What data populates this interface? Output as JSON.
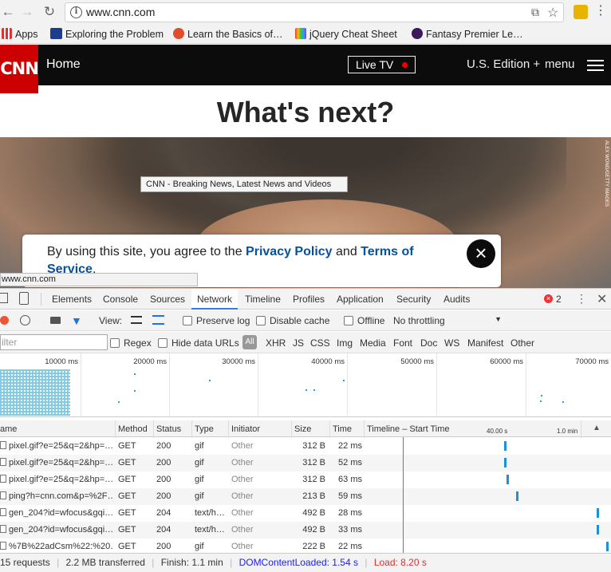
{
  "browser": {
    "url": "www.cnn.com",
    "bookmarks": [
      {
        "label": "Apps",
        "icon": "apps-grid-icon"
      },
      {
        "label": "Exploring the Problem",
        "icon": "ub-logo-icon"
      },
      {
        "label": "Learn the Basics of…",
        "icon": "jsbin-icon"
      },
      {
        "label": "jQuery Cheat Sheet",
        "icon": "rainbow-icon"
      },
      {
        "label": "Fantasy Premier Le…",
        "icon": "premier-league-icon"
      }
    ]
  },
  "cnn": {
    "logo": "CNN",
    "nav_home": "Home",
    "live_tv": "Live TV",
    "edition": "U.S. Edition +",
    "menu": "menu",
    "headline": "What's next?",
    "photo_credit": "ALEX WONG/GETTY IMAGES",
    "tooltip": "CNN - Breaking News, Latest News and Videos",
    "consent": {
      "prefix": "By using this site, you agree to the",
      "privacy": "Privacy Policy",
      "and": "and",
      "terms": "Terms of Service",
      "suffix": "."
    },
    "status_url": "www.cnn.com"
  },
  "devtools": {
    "tabs": [
      "Elements",
      "Console",
      "Sources",
      "Network",
      "Timeline",
      "Profiles",
      "Application",
      "Security",
      "Audits"
    ],
    "active_tab": "Network",
    "error_count": "2",
    "view_label": "View:",
    "preserve_log": "Preserve log",
    "disable_cache": "Disable cache",
    "offline": "Offline",
    "throttling": "No throttling",
    "filter_placeholder": "ilter",
    "regex": "Regex",
    "hide_data_urls": "Hide data URLs",
    "all": "All",
    "filter_types": [
      "XHR",
      "JS",
      "CSS",
      "Img",
      "Media",
      "Font",
      "Doc",
      "WS",
      "Manifest",
      "Other"
    ],
    "overview_ticks": [
      "10000 ms",
      "20000 ms",
      "30000 ms",
      "40000 ms",
      "50000 ms",
      "60000 ms",
      "70000 ms"
    ],
    "columns": {
      "name": "ame",
      "method": "Method",
      "status": "Status",
      "type": "Type",
      "initiator": "Initiator",
      "size": "Size",
      "time": "Time",
      "timeline": "Timeline – Start Time",
      "tl_mark1": "40.00 s",
      "tl_mark2": "1.0 min"
    },
    "requests": [
      {
        "name": "pixel.gif?e=25&q=2&hp=…",
        "method": "GET",
        "status": "200",
        "type": "gif",
        "initiator": "Other",
        "size": "312 B",
        "time": "22 ms",
        "start_fraction": 0.57
      },
      {
        "name": "pixel.gif?e=25&q=2&hp=…",
        "method": "GET",
        "status": "200",
        "type": "gif",
        "initiator": "Other",
        "size": "312 B",
        "time": "52 ms",
        "start_fraction": 0.57
      },
      {
        "name": "pixel.gif?e=25&q=2&hp=…",
        "method": "GET",
        "status": "200",
        "type": "gif",
        "initiator": "Other",
        "size": "312 B",
        "time": "63 ms",
        "start_fraction": 0.58
      },
      {
        "name": "ping?h=cnn.com&p=%2F…",
        "method": "GET",
        "status": "200",
        "type": "gif",
        "initiator": "Other",
        "size": "213 B",
        "time": "59 ms",
        "start_fraction": 0.62
      },
      {
        "name": "gen_204?id=wfocus&gqi…",
        "method": "GET",
        "status": "204",
        "type": "text/h…",
        "initiator": "Other",
        "size": "492 B",
        "time": "28 ms",
        "start_fraction": 0.95
      },
      {
        "name": "gen_204?id=wfocus&gqi…",
        "method": "GET",
        "status": "204",
        "type": "text/h…",
        "initiator": "Other",
        "size": "492 B",
        "time": "33 ms",
        "start_fraction": 0.95
      },
      {
        "name": "%7B%22adCsm%22:%20…",
        "method": "GET",
        "status": "200",
        "type": "gif",
        "initiator": "Other",
        "size": "222 B",
        "time": "22 ms",
        "start_fraction": 0.99
      }
    ],
    "summary": {
      "requests": "15 requests",
      "transferred": "2.2 MB transferred",
      "finish": "Finish: 1.1 min",
      "dcl": "DOMContentLoaded: 1.54 s",
      "load": "Load: 8.20 s"
    },
    "colors": {
      "dcl": "#1a1aff",
      "load": "#e42b2b",
      "bar": "#1e90d8"
    }
  }
}
